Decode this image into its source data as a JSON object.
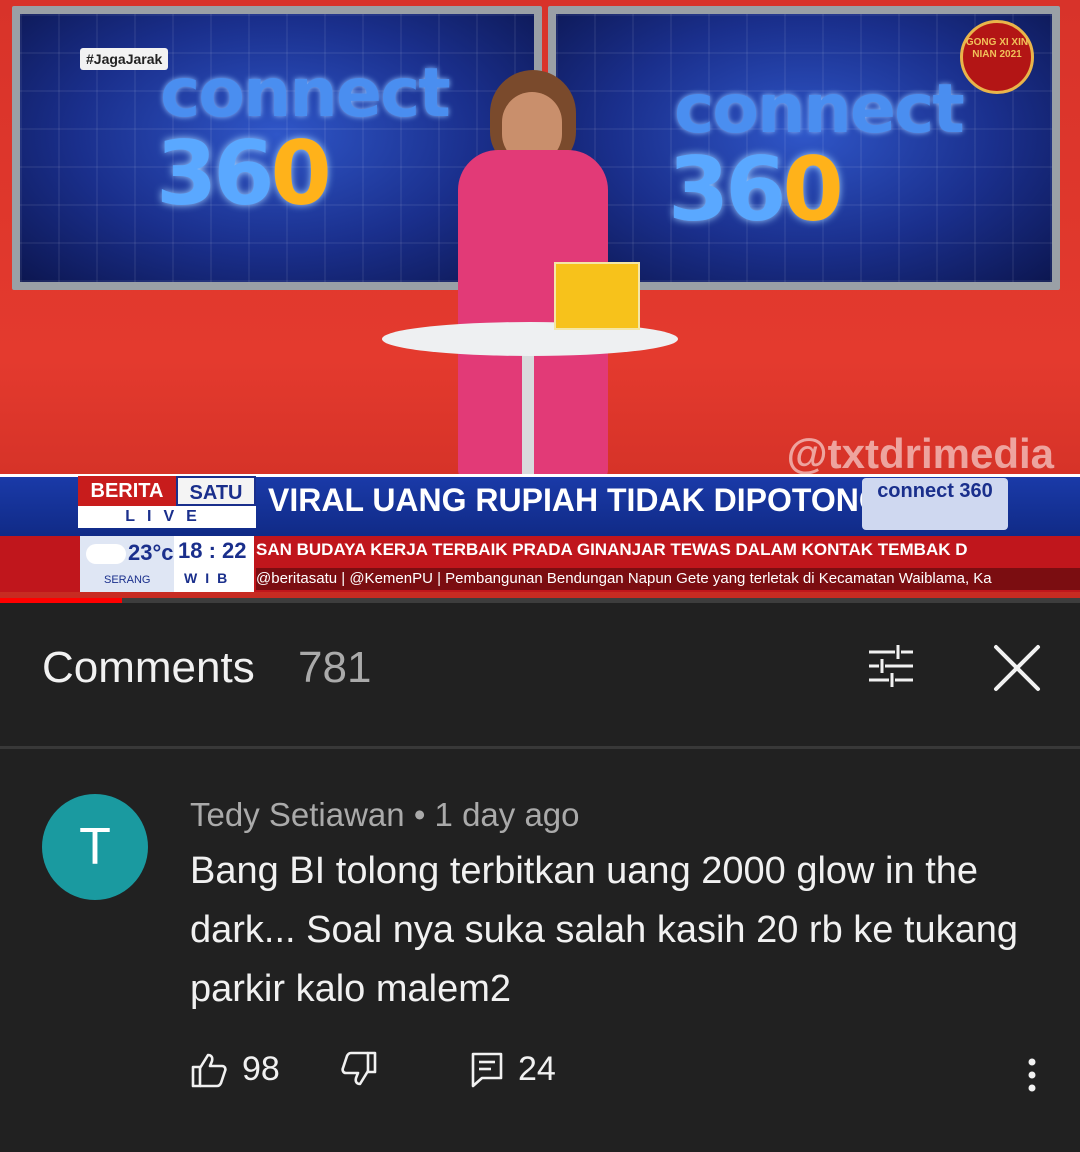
{
  "video": {
    "hashtag": "#JagaJarak",
    "brand_word": "connect",
    "brand_number_a": "36",
    "brand_number_b": "0",
    "new_year_badge": "GONG XI XIN NIAN 2021",
    "watermark": "@txtdrimedia",
    "channel_name_a": "BERITA",
    "channel_name_b": "SATU",
    "live_label": "LIVE",
    "headline": "VIRAL UANG RUPIAH TIDAK DIPOTONG",
    "mini_logo": "connect 360",
    "temperature": "23°c",
    "city": "SERANG",
    "time": "18 : 22",
    "timezone": "WIB",
    "ticker_top": "SAN BUDAYA KERJA TERBAIK   PRADA GINANJAR TEWAS DALAM KONTAK TEMBAK D",
    "ticker_bottom": "@beritasatu | @KemenPU | Pembangunan Bendungan Napun Gete yang terletak di Kecamatan Waiblama, Ka",
    "progress_fraction": 0.113,
    "accent_red": "#ff0000"
  },
  "comments": {
    "title": "Comments",
    "count": "781",
    "filter_icon": "sliders-icon",
    "close_icon": "close-icon"
  },
  "comment": {
    "avatar_letter": "T",
    "avatar_color": "#1a9aa0",
    "author": "Tedy Setiawan",
    "separator": "•",
    "time": "1 day ago",
    "text": "Bang BI tolong terbitkan uang 2000 glow in the dark... Soal nya suka salah kasih 20 rb ke tukang parkir kalo malem2",
    "likes": "98",
    "replies": "24"
  }
}
